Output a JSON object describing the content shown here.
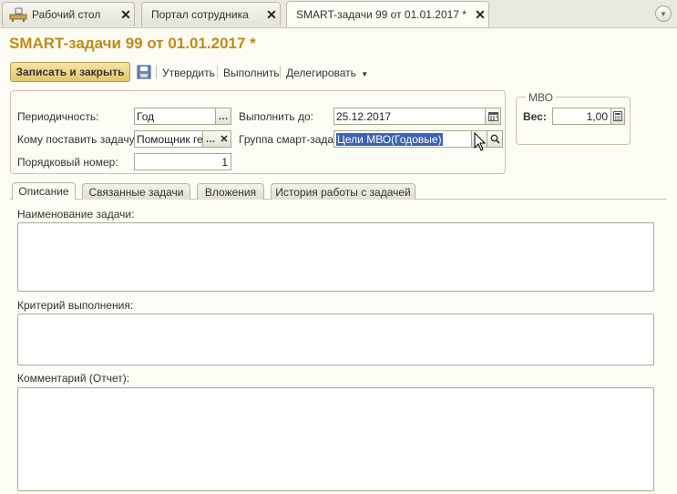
{
  "window_tabs": [
    {
      "label": "Рабочий стол",
      "icon": "desk-icon"
    },
    {
      "label": "Портал сотрудника"
    },
    {
      "label": "SMART-задачи 99 от 01.01.2017 *"
    }
  ],
  "window_tab_close": "✕",
  "title": "SMART-задачи 99 от 01.01.2017 *",
  "toolbar": {
    "save_close": "Записать и закрыть",
    "approve": "Утвердить",
    "execute": "Выполнить",
    "delegate": "Делегировать"
  },
  "form": {
    "periodicity_label": "Периодичность:",
    "periodicity_value": "Год",
    "assignee_label": "Кому поставить задачу:",
    "assignee_value": "Помощник ген",
    "order_label": "Порядковый номер:",
    "order_value": "1",
    "due_label": "Выполнить до:",
    "due_value": "25.12.2017",
    "group_label": "Группа смарт-задач:",
    "group_value": "Цели МВО(Годовые)"
  },
  "mbo": {
    "legend": "МВО",
    "weight_label": "Вес:",
    "weight_value": "1,00"
  },
  "inner_tabs": [
    "Описание",
    "Связанные задачи",
    "Вложения",
    "История работы с задачей"
  ],
  "description": {
    "name_label": "Наименование задачи:",
    "criterion_label": "Критерий выполнения:",
    "comment_label": "Комментарий (Отчет):"
  },
  "colors": {
    "accent": "#c38a13",
    "primary_button": "#e4c56d",
    "selection": "#3b62b6"
  }
}
